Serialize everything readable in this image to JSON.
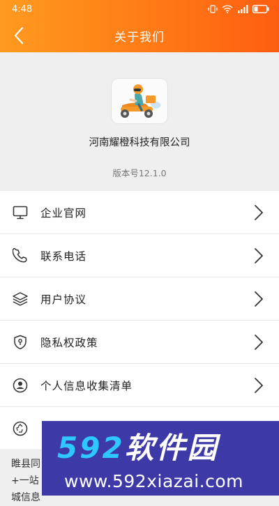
{
  "status": {
    "time": "4:48"
  },
  "header": {
    "title": "关于我们"
  },
  "about": {
    "company": "河南耀橙科技有限公司",
    "version": "版本号12.1.0"
  },
  "menu": {
    "items": [
      {
        "label": "企业官网",
        "icon": "monitor-icon"
      },
      {
        "label": "联系电话",
        "icon": "phone-icon"
      },
      {
        "label": "用户协议",
        "icon": "layers-icon"
      },
      {
        "label": "隐私权政策",
        "icon": "shield-icon"
      },
      {
        "label": "个人信息收集清单",
        "icon": "user-circle-icon"
      },
      {
        "label": "",
        "icon": "recycle-icon"
      }
    ]
  },
  "footer": {
    "line1": "睢县同",
    "line2": "+一站",
    "line3": "城信息"
  },
  "watermark": {
    "num": "592",
    "cn": "软件园",
    "url": "www.592xiazai.com"
  },
  "colors": {
    "header_start": "#ff9a1f",
    "header_end": "#ff5e10",
    "watermark_bg": "#3d3aa8",
    "watermark_accent": "#2ec8ff"
  }
}
